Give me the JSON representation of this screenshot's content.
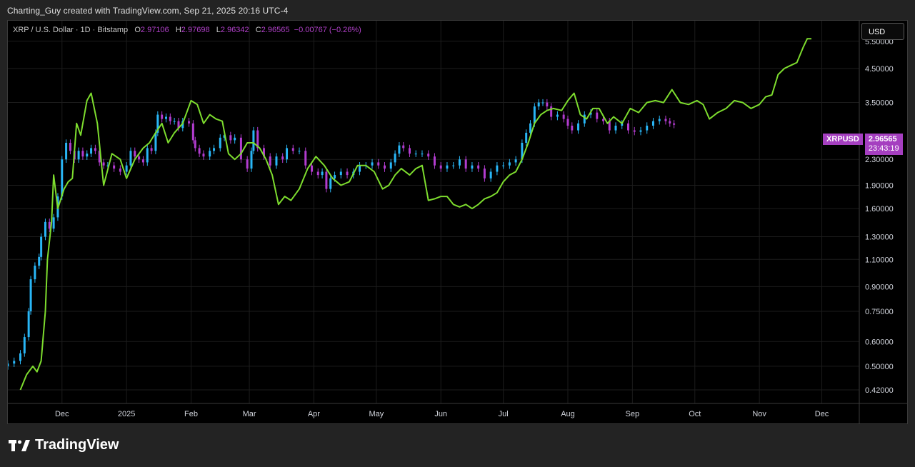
{
  "header": {
    "text": "Charting_Guy created with TradingView.com, Sep 21, 2025 20:16 UTC-4"
  },
  "legend": {
    "symbol": "XRP / U.S. Dollar · 1D · Bitstamp",
    "o_label": "O",
    "o_value": "2.97106",
    "h_label": "H",
    "h_value": "2.97698",
    "l_label": "L",
    "l_value": "2.96342",
    "c_label": "C",
    "c_value": "2.96565",
    "change": "−0.00767 (−0.26%)"
  },
  "currency_button": "USD",
  "price_tag": {
    "symbol": "XRPUSD",
    "price": "2.96565",
    "countdown": "23:43:19"
  },
  "footer": {
    "brand": "TradingView"
  },
  "colors": {
    "candle_up": "#29b6f6",
    "candle_down": "#b23ccf",
    "overlay_line": "#7ddc2e",
    "price_tag": "#a53fc0",
    "background": "#000000"
  },
  "chart_data": {
    "type": "line",
    "scale": "log",
    "ylim": [
      0.38,
      6.4
    ],
    "y_ticks": [
      5.5,
      4.5,
      3.5,
      2.3,
      1.9,
      1.6,
      1.3,
      1.1,
      0.9,
      0.75,
      0.6,
      0.5,
      0.42
    ],
    "y_tick_labels": [
      "5.50000",
      "4.50000",
      "3.50000",
      "2.30000",
      "1.90000",
      "1.60000",
      "1.30000",
      "1.10000",
      "0.90000",
      "0.75000",
      "0.60000",
      "0.50000",
      "0.42000"
    ],
    "x_range": [
      "2024-11-05",
      "2025-12-19"
    ],
    "x_ticks": [
      {
        "label": "Dec",
        "date": "2024-12-01"
      },
      {
        "label": "2025",
        "date": "2025-01-01"
      },
      {
        "label": "Feb",
        "date": "2025-02-01"
      },
      {
        "label": "Mar",
        "date": "2025-03-01"
      },
      {
        "label": "Apr",
        "date": "2025-04-01"
      },
      {
        "label": "May",
        "date": "2025-05-01"
      },
      {
        "label": "Jun",
        "date": "2025-06-01"
      },
      {
        "label": "Jul",
        "date": "2025-07-01"
      },
      {
        "label": "Aug",
        "date": "2025-08-01"
      },
      {
        "label": "Sep",
        "date": "2025-09-01"
      },
      {
        "label": "Oct",
        "date": "2025-10-01"
      },
      {
        "label": "Nov",
        "date": "2025-11-01"
      },
      {
        "label": "Dec",
        "date": "2025-12-01"
      }
    ],
    "series": [
      {
        "kind": "candles",
        "points": [
          [
            "2024-11-05",
            0.51
          ],
          [
            "2024-11-08",
            0.52
          ],
          [
            "2024-11-11",
            0.55
          ],
          [
            "2024-11-13",
            0.62
          ],
          [
            "2024-11-15",
            0.75
          ],
          [
            "2024-11-16",
            0.95
          ],
          [
            "2024-11-18",
            1.05
          ],
          [
            "2024-11-20",
            1.12
          ],
          [
            "2024-11-21",
            1.3
          ],
          [
            "2024-11-23",
            1.45
          ],
          [
            "2024-11-25",
            1.38
          ],
          [
            "2024-11-27",
            1.5
          ],
          [
            "2024-11-29",
            1.75
          ],
          [
            "2024-12-01",
            2.3
          ],
          [
            "2024-12-03",
            2.6
          ],
          [
            "2024-12-05",
            2.45
          ],
          [
            "2024-12-07",
            2.3
          ],
          [
            "2024-12-09",
            2.45
          ],
          [
            "2024-12-11",
            2.35
          ],
          [
            "2024-12-13",
            2.4
          ],
          [
            "2024-12-15",
            2.5
          ],
          [
            "2024-12-17",
            2.45
          ],
          [
            "2024-12-19",
            2.25
          ],
          [
            "2024-12-21",
            2.2
          ],
          [
            "2024-12-23",
            2.2
          ],
          [
            "2024-12-26",
            2.15
          ],
          [
            "2024-12-29",
            2.1
          ],
          [
            "2025-01-01",
            2.2
          ],
          [
            "2025-01-03",
            2.45
          ],
          [
            "2025-01-05",
            2.35
          ],
          [
            "2025-01-07",
            2.3
          ],
          [
            "2025-01-09",
            2.25
          ],
          [
            "2025-01-11",
            2.5
          ],
          [
            "2025-01-13",
            2.45
          ],
          [
            "2025-01-15",
            2.8
          ],
          [
            "2025-01-16",
            3.2
          ],
          [
            "2025-01-18",
            3.1
          ],
          [
            "2025-01-20",
            3.15
          ],
          [
            "2025-01-22",
            3.05
          ],
          [
            "2025-01-24",
            3.05
          ],
          [
            "2025-01-26",
            2.9
          ],
          [
            "2025-01-28",
            3.05
          ],
          [
            "2025-01-31",
            3.0
          ],
          [
            "2025-02-02",
            2.65
          ],
          [
            "2025-02-03",
            2.5
          ],
          [
            "2025-02-05",
            2.4
          ],
          [
            "2025-02-07",
            2.35
          ],
          [
            "2025-02-10",
            2.45
          ],
          [
            "2025-02-12",
            2.5
          ],
          [
            "2025-02-15",
            2.7
          ],
          [
            "2025-02-17",
            2.75
          ],
          [
            "2025-02-20",
            2.65
          ],
          [
            "2025-02-22",
            2.7
          ],
          [
            "2025-02-25",
            2.3
          ],
          [
            "2025-02-28",
            2.15
          ],
          [
            "2025-03-02",
            2.45
          ],
          [
            "2025-03-03",
            2.85
          ],
          [
            "2025-03-05",
            2.5
          ],
          [
            "2025-03-08",
            2.35
          ],
          [
            "2025-03-11",
            2.2
          ],
          [
            "2025-03-14",
            2.35
          ],
          [
            "2025-03-17",
            2.3
          ],
          [
            "2025-03-19",
            2.5
          ],
          [
            "2025-03-22",
            2.45
          ],
          [
            "2025-03-25",
            2.45
          ],
          [
            "2025-03-28",
            2.2
          ],
          [
            "2025-03-31",
            2.1
          ],
          [
            "2025-04-03",
            2.05
          ],
          [
            "2025-04-05",
            2.1
          ],
          [
            "2025-04-07",
            1.85
          ],
          [
            "2025-04-09",
            2.0
          ],
          [
            "2025-04-11",
            2.05
          ],
          [
            "2025-04-14",
            2.1
          ],
          [
            "2025-04-17",
            2.05
          ],
          [
            "2025-04-20",
            2.1
          ],
          [
            "2025-04-23",
            2.2
          ],
          [
            "2025-04-26",
            2.2
          ],
          [
            "2025-04-29",
            2.25
          ],
          [
            "2025-05-02",
            2.2
          ],
          [
            "2025-05-05",
            2.15
          ],
          [
            "2025-05-08",
            2.25
          ],
          [
            "2025-05-10",
            2.4
          ],
          [
            "2025-05-12",
            2.55
          ],
          [
            "2025-05-14",
            2.5
          ],
          [
            "2025-05-17",
            2.4
          ],
          [
            "2025-05-20",
            2.4
          ],
          [
            "2025-05-23",
            2.4
          ],
          [
            "2025-05-26",
            2.35
          ],
          [
            "2025-05-29",
            2.2
          ],
          [
            "2025-06-01",
            2.15
          ],
          [
            "2025-06-04",
            2.2
          ],
          [
            "2025-06-07",
            2.2
          ],
          [
            "2025-06-10",
            2.3
          ],
          [
            "2025-06-13",
            2.15
          ],
          [
            "2025-06-16",
            2.2
          ],
          [
            "2025-06-19",
            2.15
          ],
          [
            "2025-06-22",
            2.0
          ],
          [
            "2025-06-25",
            2.1
          ],
          [
            "2025-06-28",
            2.2
          ],
          [
            "2025-07-01",
            2.2
          ],
          [
            "2025-07-04",
            2.25
          ],
          [
            "2025-07-07",
            2.3
          ],
          [
            "2025-07-10",
            2.6
          ],
          [
            "2025-07-12",
            2.8
          ],
          [
            "2025-07-14",
            3.0
          ],
          [
            "2025-07-16",
            3.4
          ],
          [
            "2025-07-18",
            3.5
          ],
          [
            "2025-07-20",
            3.5
          ],
          [
            "2025-07-22",
            3.4
          ],
          [
            "2025-07-24",
            3.15
          ],
          [
            "2025-07-27",
            3.2
          ],
          [
            "2025-07-30",
            3.1
          ],
          [
            "2025-08-01",
            2.95
          ],
          [
            "2025-08-03",
            2.85
          ],
          [
            "2025-08-06",
            3.0
          ],
          [
            "2025-08-09",
            3.2
          ],
          [
            "2025-08-12",
            3.25
          ],
          [
            "2025-08-15",
            3.1
          ],
          [
            "2025-08-18",
            3.05
          ],
          [
            "2025-08-21",
            2.85
          ],
          [
            "2025-08-24",
            2.95
          ],
          [
            "2025-08-27",
            3.0
          ],
          [
            "2025-08-30",
            2.85
          ],
          [
            "2025-09-02",
            2.82
          ],
          [
            "2025-09-05",
            2.85
          ],
          [
            "2025-09-08",
            2.95
          ],
          [
            "2025-09-11",
            3.05
          ],
          [
            "2025-09-14",
            3.1
          ],
          [
            "2025-09-17",
            3.05
          ],
          [
            "2025-09-19",
            3.0
          ],
          [
            "2025-09-21",
            2.97
          ]
        ]
      },
      {
        "kind": "line",
        "points": [
          [
            "2024-11-11",
            0.42
          ],
          [
            "2024-11-14",
            0.47
          ],
          [
            "2024-11-17",
            0.5
          ],
          [
            "2024-11-19",
            0.48
          ],
          [
            "2024-11-21",
            0.52
          ],
          [
            "2024-11-23",
            0.75
          ],
          [
            "2024-11-24",
            1.1
          ],
          [
            "2024-11-26",
            1.45
          ],
          [
            "2024-11-27",
            2.05
          ],
          [
            "2024-11-29",
            1.6
          ],
          [
            "2024-12-02",
            1.85
          ],
          [
            "2024-12-04",
            1.95
          ],
          [
            "2024-12-06",
            2.0
          ],
          [
            "2024-12-08",
            3.0
          ],
          [
            "2024-12-10",
            2.75
          ],
          [
            "2024-12-13",
            3.55
          ],
          [
            "2024-12-15",
            3.75
          ],
          [
            "2024-12-18",
            3.0
          ],
          [
            "2024-12-21",
            1.9
          ],
          [
            "2024-12-25",
            2.4
          ],
          [
            "2024-12-29",
            2.3
          ],
          [
            "2025-01-01",
            2.0
          ],
          [
            "2025-01-05",
            2.3
          ],
          [
            "2025-01-09",
            2.5
          ],
          [
            "2025-01-12",
            2.6
          ],
          [
            "2025-01-15",
            2.8
          ],
          [
            "2025-01-18",
            3.0
          ],
          [
            "2025-01-21",
            2.6
          ],
          [
            "2025-01-24",
            2.8
          ],
          [
            "2025-01-28",
            3.0
          ],
          [
            "2025-02-01",
            3.55
          ],
          [
            "2025-02-04",
            3.45
          ],
          [
            "2025-02-07",
            3.0
          ],
          [
            "2025-02-10",
            3.2
          ],
          [
            "2025-02-13",
            3.1
          ],
          [
            "2025-02-16",
            3.05
          ],
          [
            "2025-02-19",
            2.4
          ],
          [
            "2025-02-22",
            2.3
          ],
          [
            "2025-02-25",
            2.4
          ],
          [
            "2025-02-28",
            2.6
          ],
          [
            "2025-03-03",
            2.6
          ],
          [
            "2025-03-06",
            2.5
          ],
          [
            "2025-03-09",
            2.3
          ],
          [
            "2025-03-12",
            2.05
          ],
          [
            "2025-03-15",
            1.65
          ],
          [
            "2025-03-18",
            1.75
          ],
          [
            "2025-03-21",
            1.7
          ],
          [
            "2025-03-25",
            1.85
          ],
          [
            "2025-03-29",
            2.15
          ],
          [
            "2025-04-02",
            2.35
          ],
          [
            "2025-04-06",
            2.2
          ],
          [
            "2025-04-10",
            2.0
          ],
          [
            "2025-04-14",
            1.9
          ],
          [
            "2025-04-18",
            1.95
          ],
          [
            "2025-04-22",
            2.2
          ],
          [
            "2025-04-26",
            2.2
          ],
          [
            "2025-04-30",
            2.1
          ],
          [
            "2025-05-04",
            1.85
          ],
          [
            "2025-05-07",
            1.9
          ],
          [
            "2025-05-10",
            2.05
          ],
          [
            "2025-05-13",
            2.15
          ],
          [
            "2025-05-17",
            2.05
          ],
          [
            "2025-05-20",
            2.15
          ],
          [
            "2025-05-23",
            2.2
          ],
          [
            "2025-05-26",
            1.7
          ],
          [
            "2025-05-29",
            1.72
          ],
          [
            "2025-06-01",
            1.75
          ],
          [
            "2025-06-04",
            1.75
          ],
          [
            "2025-06-07",
            1.65
          ],
          [
            "2025-06-10",
            1.62
          ],
          [
            "2025-06-13",
            1.65
          ],
          [
            "2025-06-16",
            1.6
          ],
          [
            "2025-06-19",
            1.65
          ],
          [
            "2025-06-22",
            1.72
          ],
          [
            "2025-06-25",
            1.75
          ],
          [
            "2025-06-28",
            1.8
          ],
          [
            "2025-07-01",
            1.95
          ],
          [
            "2025-07-04",
            2.05
          ],
          [
            "2025-07-07",
            2.1
          ],
          [
            "2025-07-10",
            2.3
          ],
          [
            "2025-07-13",
            2.6
          ],
          [
            "2025-07-16",
            3.0
          ],
          [
            "2025-07-19",
            3.2
          ],
          [
            "2025-07-22",
            3.3
          ],
          [
            "2025-07-25",
            3.35
          ],
          [
            "2025-07-29",
            3.3
          ],
          [
            "2025-08-01",
            3.55
          ],
          [
            "2025-08-04",
            3.75
          ],
          [
            "2025-08-07",
            3.2
          ],
          [
            "2025-08-10",
            3.1
          ],
          [
            "2025-08-13",
            3.35
          ],
          [
            "2025-08-16",
            3.35
          ],
          [
            "2025-08-20",
            3.0
          ],
          [
            "2025-08-23",
            3.15
          ],
          [
            "2025-08-27",
            3.0
          ],
          [
            "2025-08-31",
            3.35
          ],
          [
            "2025-09-04",
            3.25
          ],
          [
            "2025-09-08",
            3.5
          ],
          [
            "2025-09-12",
            3.55
          ],
          [
            "2025-09-16",
            3.5
          ],
          [
            "2025-09-20",
            3.85
          ],
          [
            "2025-09-24",
            3.5
          ],
          [
            "2025-09-28",
            3.45
          ],
          [
            "2025-10-02",
            3.55
          ],
          [
            "2025-10-05",
            3.45
          ],
          [
            "2025-10-08",
            3.1
          ],
          [
            "2025-10-12",
            3.25
          ],
          [
            "2025-10-16",
            3.35
          ],
          [
            "2025-10-20",
            3.55
          ],
          [
            "2025-10-24",
            3.5
          ],
          [
            "2025-10-28",
            3.35
          ],
          [
            "2025-11-01",
            3.45
          ],
          [
            "2025-11-04",
            3.65
          ],
          [
            "2025-11-07",
            3.7
          ],
          [
            "2025-11-10",
            4.3
          ],
          [
            "2025-11-13",
            4.5
          ],
          [
            "2025-11-16",
            4.6
          ],
          [
            "2025-11-19",
            4.7
          ],
          [
            "2025-11-22",
            5.25
          ],
          [
            "2025-11-24",
            5.6
          ],
          [
            "2025-11-26",
            5.6
          ]
        ]
      }
    ]
  }
}
